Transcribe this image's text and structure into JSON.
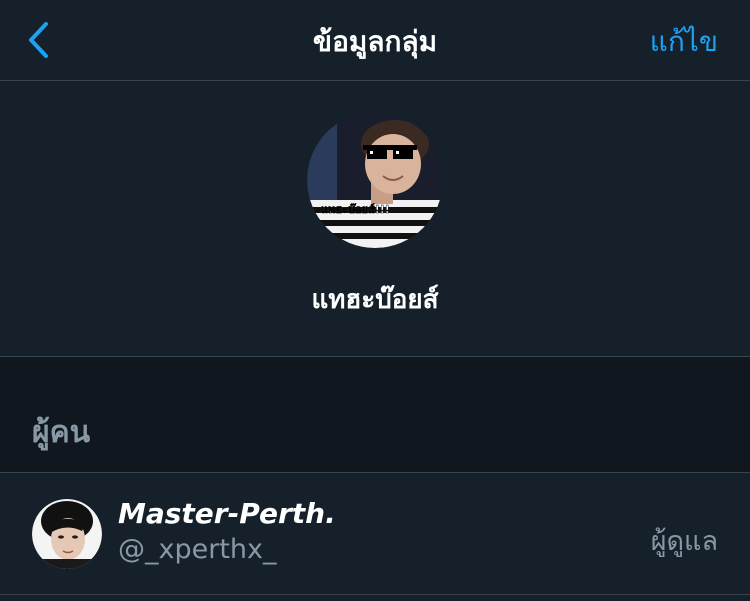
{
  "nav": {
    "title": "ข้อมูลกลุ่ม",
    "edit_label": "แก้ไข",
    "accent_color": "#1da1f2"
  },
  "group": {
    "name": "แทฮะบ๊อยส์",
    "avatar_caption": "แทฮะบ๊อยส์!!!"
  },
  "people_section": {
    "label": "ผู้คน",
    "members": [
      {
        "display_name": "Master-Perth.",
        "handle": "@_xperthx_",
        "role": "ผู้ดูแล"
      }
    ]
  },
  "colors": {
    "background": "#15202b",
    "section_background": "#10171e",
    "divider": "#38444d",
    "secondary_text": "#8899a6"
  }
}
